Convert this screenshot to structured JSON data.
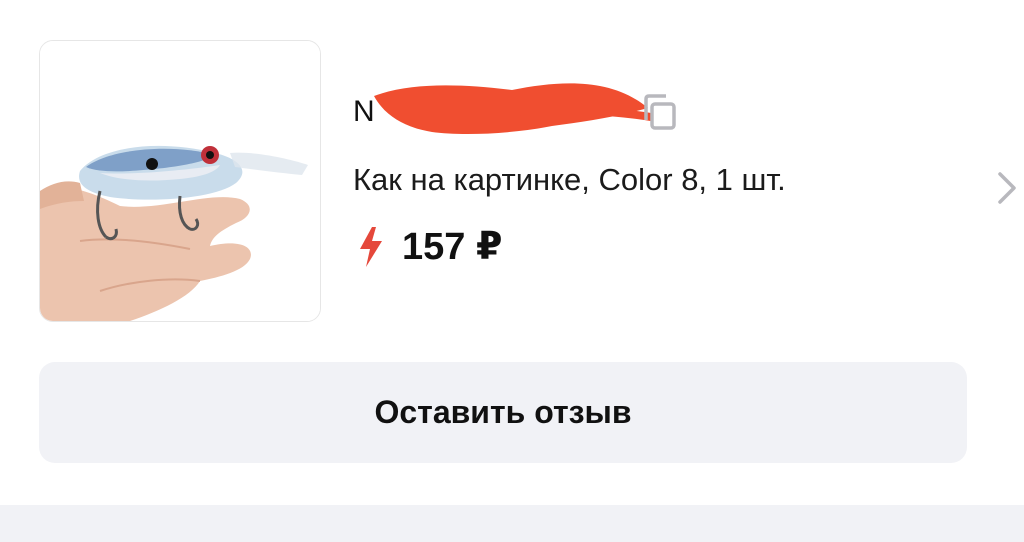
{
  "order_item": {
    "id_prefix": "N",
    "variant": "Как на картинке, Color 8, 1 шт.",
    "price": "157 ₽"
  },
  "review_button": {
    "label": "Оставить отзыв"
  },
  "icons": {
    "copy": "copy-icon",
    "price_badge": "lightning-icon",
    "navigate": "chevron-right-icon"
  },
  "colors": {
    "accent": "#e5483b",
    "redaction": "#f04e30",
    "button_bg": "#f1f2f6",
    "chevron": "#b8b8bd"
  }
}
